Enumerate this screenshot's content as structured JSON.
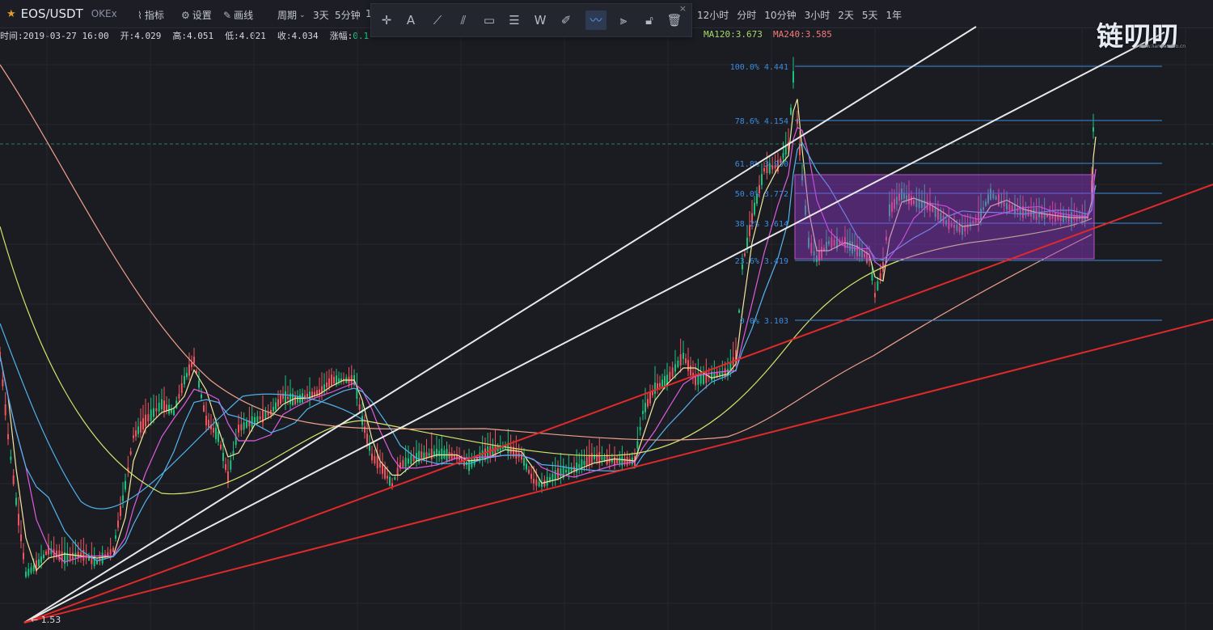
{
  "header": {
    "symbol": "EOS/USDT",
    "exchange": "OKEx",
    "indicators_label": "指标",
    "settings_label": "设置",
    "draw_label": "画线",
    "period_label": "周期",
    "period_3d": "3天",
    "period_5m": "5分钟",
    "period_1": "1"
  },
  "periods": [
    "12小时",
    "分时",
    "10分钟",
    "3小时",
    "2天",
    "5天",
    "1年"
  ],
  "draw_toolbar": {
    "tools": [
      "crosshair",
      "text",
      "trend-line",
      "parallel-channel",
      "rectangle",
      "fib-retracement",
      "wave",
      "ruler",
      "brush",
      "measure",
      "lock",
      "trash"
    ],
    "active_tool": "brush",
    "close": "×"
  },
  "info_bar": {
    "time": "时间:2019-03-27 16:00",
    "open": "开:4.029",
    "high": "高:4.051",
    "low": "低:4.021",
    "close": "收:4.034",
    "change_label": "涨幅:",
    "change_value": "0.1"
  },
  "moving_averages": [
    {
      "label": "MA120:3.673",
      "color": "#a5d86e"
    },
    {
      "label": "MA240:3.585",
      "color": "#f07c7c"
    }
  ],
  "fib_levels": [
    {
      "label": "100.0% 4.441",
      "price": 4.441
    },
    {
      "label": "78.6% 4.154",
      "price": 4.154
    },
    {
      "label": "61.8% 3.930",
      "price": 3.93
    },
    {
      "label": "50.0% 3.772",
      "price": 3.772
    },
    {
      "label": "38.2% 3.614",
      "price": 3.614
    },
    {
      "label": "23.6% 3.419",
      "price": 3.419
    },
    {
      "label": "0.0% 3.103",
      "price": 3.103
    }
  ],
  "low_marker": "← 1.53",
  "watermark": "链叨叨",
  "watermark_sub": "www.liandaodao.cn",
  "colors": {
    "background": "#1b1c22",
    "up": "#19c37d",
    "down": "#f0555f",
    "fib": "#3d8be0",
    "box": "#9b3ad6",
    "trendline_red": "#e02a2a",
    "trendline_white": "#e8e8e8"
  }
}
